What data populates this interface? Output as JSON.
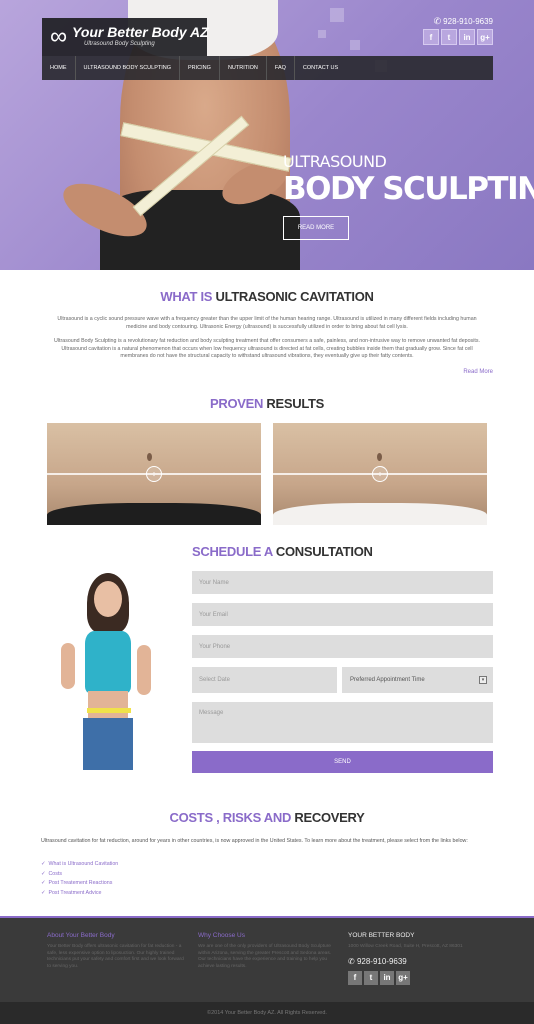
{
  "brand": {
    "name": "Your Better Body AZ",
    "tagline": "Ultrasound Body Sculpting"
  },
  "header": {
    "phone": "928-910-9639",
    "social": [
      "f",
      "t",
      "in",
      "g+"
    ]
  },
  "nav": {
    "items": [
      "HOME",
      "ULTRASOUND BODY SCULPTING",
      "PRICING",
      "NUTRITION",
      "FAQ",
      "CONTACT US"
    ]
  },
  "hero": {
    "subtitle": "ULTRASOUND",
    "title": "BODY SCULPTING",
    "button": "READ MORE"
  },
  "cavitation": {
    "heading_accent": "WHAT IS",
    "heading_rest": "ULTRASONIC CAVITATION",
    "p1": "Ultrasound is a cyclic sound pressure wave with a frequency greater than the upper limit of the human hearing range. Ultrasound is utilized in many different fields including human medicine and body contouring. Ultrasonic Energy (ultrasound) is successfully utilized in order to bring about fat cell lysis.",
    "p2": "Ultrasound Body Sculpting is a revolutionary fat reduction and body sculpting treatment that offer consumers a safe, painless, and non-intrusive way to remove unwanted fat deposits. Ultrasound cavitation is a natural phenomenon that occurs when low frequency ultrasound is directed at fat cells, creating bubbles inside them that gradually grow. Since fat cell membranes do not have the structural capacity to withstand ultrasound vibrations, they eventually give up their fatty contents.",
    "read_more": "Read More"
  },
  "results": {
    "heading_accent": "PROVEN",
    "heading_rest": "RESULTS"
  },
  "consultation": {
    "heading_accent": "SCHEDULE A",
    "heading_rest": "CONSULTATION",
    "name_placeholder": "Your Name",
    "email_placeholder": "Your Email",
    "phone_placeholder": "Your Phone",
    "date_placeholder": "Select Date",
    "time_selected": "Preferred Appointment Time",
    "message_placeholder": "Message",
    "send": "SEND"
  },
  "costs": {
    "heading_accent": "COSTS , RISKS AND",
    "heading_rest": "RECOVERY",
    "text": "Ultrasound cavitation for fat reduction, around for years in other countries, is now approved in the United States. To learn more about the treatment, please select from the links below:",
    "links": [
      "What is Ultrasound Cavitation",
      "Costs",
      "Post Treatement Reactions",
      "Post Treatment Advice"
    ]
  },
  "footer": {
    "about_title": "About Your Better Body",
    "about_text": "Your Better Body offers ultrasonic cavitation for fat reduction - a safe, less expensive option to liposuction. Our highly trained technicians put your safety and comfort first and we look forward to serving you.",
    "why_title": "Why Choose Us",
    "why_text": "We are one of the only providers of Ultrasound Body Sculpture within Arizona, serving the greater Prescott and Sedona areas. Our technicians have the experience and training to help you achieve lasting results.",
    "contact_title": "YOUR BETTER BODY",
    "address": "1000 Willow Creek Road, Suite H, Prescott, AZ 86301",
    "phone": "928-910-9639",
    "copyright": "©2014 Your Better Body AZ. All Rights Reserved."
  },
  "colors": {
    "accent": "#8a6bc9",
    "hero": "#9a86cc",
    "footer": "#3a3a3a"
  }
}
